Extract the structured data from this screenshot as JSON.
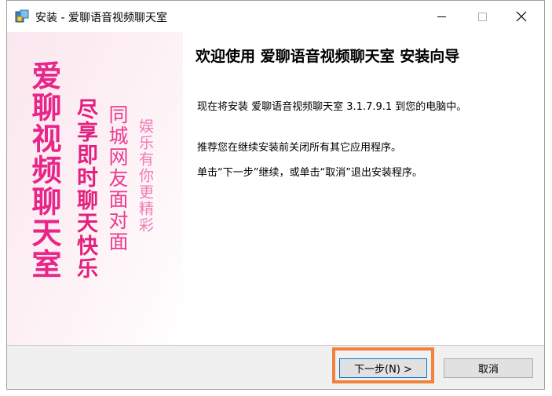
{
  "window": {
    "title": "安装 - 爱聊语音视频聊天室"
  },
  "banner": {
    "line1": "爱聊视频聊天室",
    "line2": "尽享即时聊天快乐",
    "line3": "同城网友面对面",
    "line4": "娱乐有你更精彩"
  },
  "content": {
    "heading": "欢迎使用 爱聊语音视频聊天室 安装向导",
    "para1": "现在将安装 爱聊语音视频聊天室 3.1.7.9.1 到您的电脑中。",
    "para2": "推荐您在继续安装前关闭所有其它应用程序。",
    "para3": "单击“下一步”继续，或单击“取消”退出安装程序。"
  },
  "buttons": {
    "next_label": "下一步(N) >",
    "cancel_label": "取消"
  },
  "colors": {
    "banner_primary": "#e8268a",
    "highlight": "#f2813e",
    "focus_border": "#0078d7"
  }
}
